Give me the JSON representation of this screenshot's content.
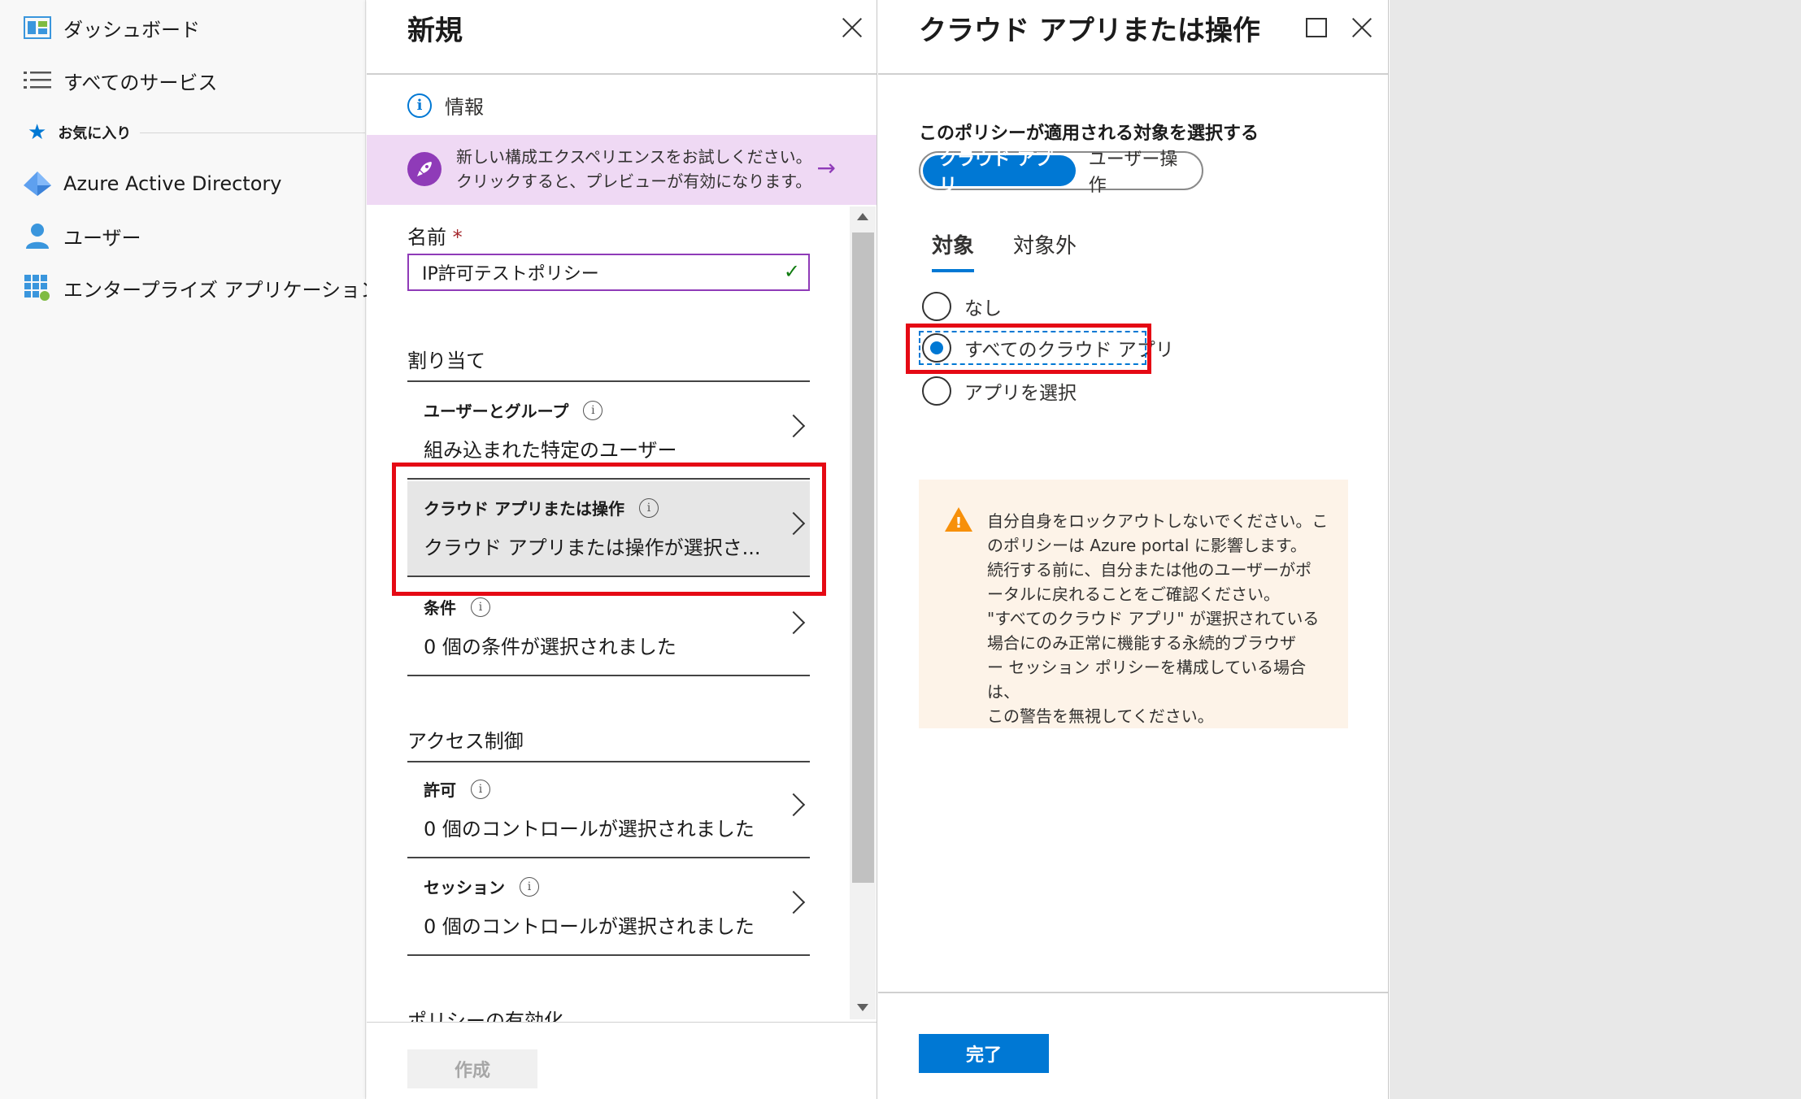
{
  "nav": {
    "dashboard": "ダッシュボード",
    "all_services": "すべてのサービス",
    "favorites": "お気に入り",
    "aad": "Azure Active Directory",
    "users": "ユーザー",
    "enterprise_apps": "エンタープライズ アプリケーション"
  },
  "blade_new": {
    "title": "新規",
    "info": "情報",
    "promo_line1": "新しい構成エクスペリエンスをお試しください。",
    "promo_line2": "クリックすると、プレビューが有効になります。",
    "name_label": "名前",
    "required_mark": "*",
    "name_value": "IP許可テストポリシー",
    "assign_title": "割り当て",
    "users_title": "ユーザーとグループ",
    "users_value": "組み込まれた特定のユーザー",
    "cloud_title": "クラウド アプリまたは操作",
    "cloud_value": "クラウド アプリまたは操作が選択さ...",
    "cond_title": "条件",
    "cond_value": "0 個の条件が選択されました",
    "access_title": "アクセス制御",
    "grant_title": "許可",
    "grant_value": "0 個のコントロールが選択されました",
    "session_title": "セッション",
    "session_value": "0 個のコントロールが選択されました",
    "enable_title": "ポリシーの有効化",
    "create_button": "作成"
  },
  "blade_cloud": {
    "title": "クラウド アプリまたは操作",
    "prompt": "このポリシーが適用される対象を選択する",
    "toggle_on": "クラウド アプリ",
    "toggle_off": "ユーザー操作",
    "tab_include": "対象",
    "tab_exclude": "対象外",
    "radio_none": "なし",
    "radio_all": "すべてのクラウド アプリ",
    "radio_select": "アプリを選択",
    "warning": "自分自身をロックアウトしないでください。こ\nのポリシーは Azure portal に影響します。\n続行する前に、自分または他のユーザーがポ\nータルに戻れることをご確認ください。\n\"すべてのクラウド アプリ\" が選択されている\n場合にのみ正常に機能する永続的ブラウザ\nー セッション ポリシーを構成している場合は、\nこの警告を無視してください。",
    "done_button": "完了"
  },
  "colors": {
    "accent": "#0078d4",
    "highlight": "#e50914",
    "promo": "#efd9f4",
    "warning_bg": "#fdf3e8"
  }
}
